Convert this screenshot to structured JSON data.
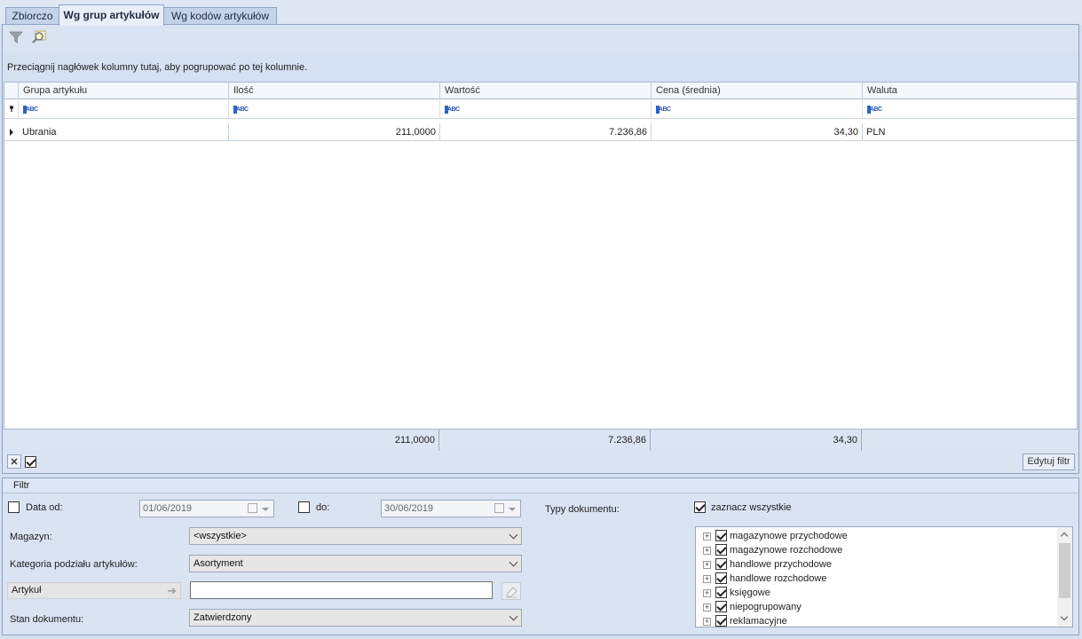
{
  "tabs": [
    {
      "label": "Zbiorczo"
    },
    {
      "label": "Wg grup artykułów"
    },
    {
      "label": "Wg kodów artykułów"
    }
  ],
  "active_tab": "Wg grup artykułów",
  "toolbar": {
    "icons": [
      "filter-icon",
      "search-icon"
    ]
  },
  "group_hint": "Przeciągnij nagłówek kolumny tutaj, aby pogrupować po tej kolumnie.",
  "grid": {
    "columns": [
      "Grupa artykułu",
      "Ilość",
      "Wartość",
      "Cena (średnia)",
      "Waluta"
    ],
    "filter_icon_label": "ABC",
    "rows": [
      {
        "grupa": "Ubrania",
        "ilosc": "211,0000",
        "wartosc": "7.236,86",
        "cena": "34,30",
        "waluta": "PLN"
      }
    ],
    "totals": {
      "ilosc": "211,0000",
      "wartosc": "7.236,86",
      "cena": "34,30"
    }
  },
  "edit_filter_label": "Edytuj filtr",
  "filter": {
    "title": "Filtr",
    "date_from_label": "Data od:",
    "date_from_value": "01/06/2019",
    "date_to_label": "do:",
    "date_to_value": "30/06/2019",
    "magazyn_label": "Magazyn:",
    "magazyn_value": "<wszystkie>",
    "kategoria_label": "Kategoria podziału artykułów:",
    "kategoria_value": "Asortyment",
    "artykul_label": "Artykuł",
    "artykul_value": "",
    "stan_label": "Stan dokumentu:",
    "stan_value": "Zatwierdzony",
    "typy_label": "Typy dokumentu:",
    "select_all_label": "zaznacz wszystkie",
    "doc_types": [
      "magazynowe przychodowe",
      "magazynowe rozchodowe",
      "handlowe przychodowe",
      "handlowe rozchodowe",
      "księgowe",
      "niepogrupowany",
      "reklamacyjne"
    ]
  }
}
